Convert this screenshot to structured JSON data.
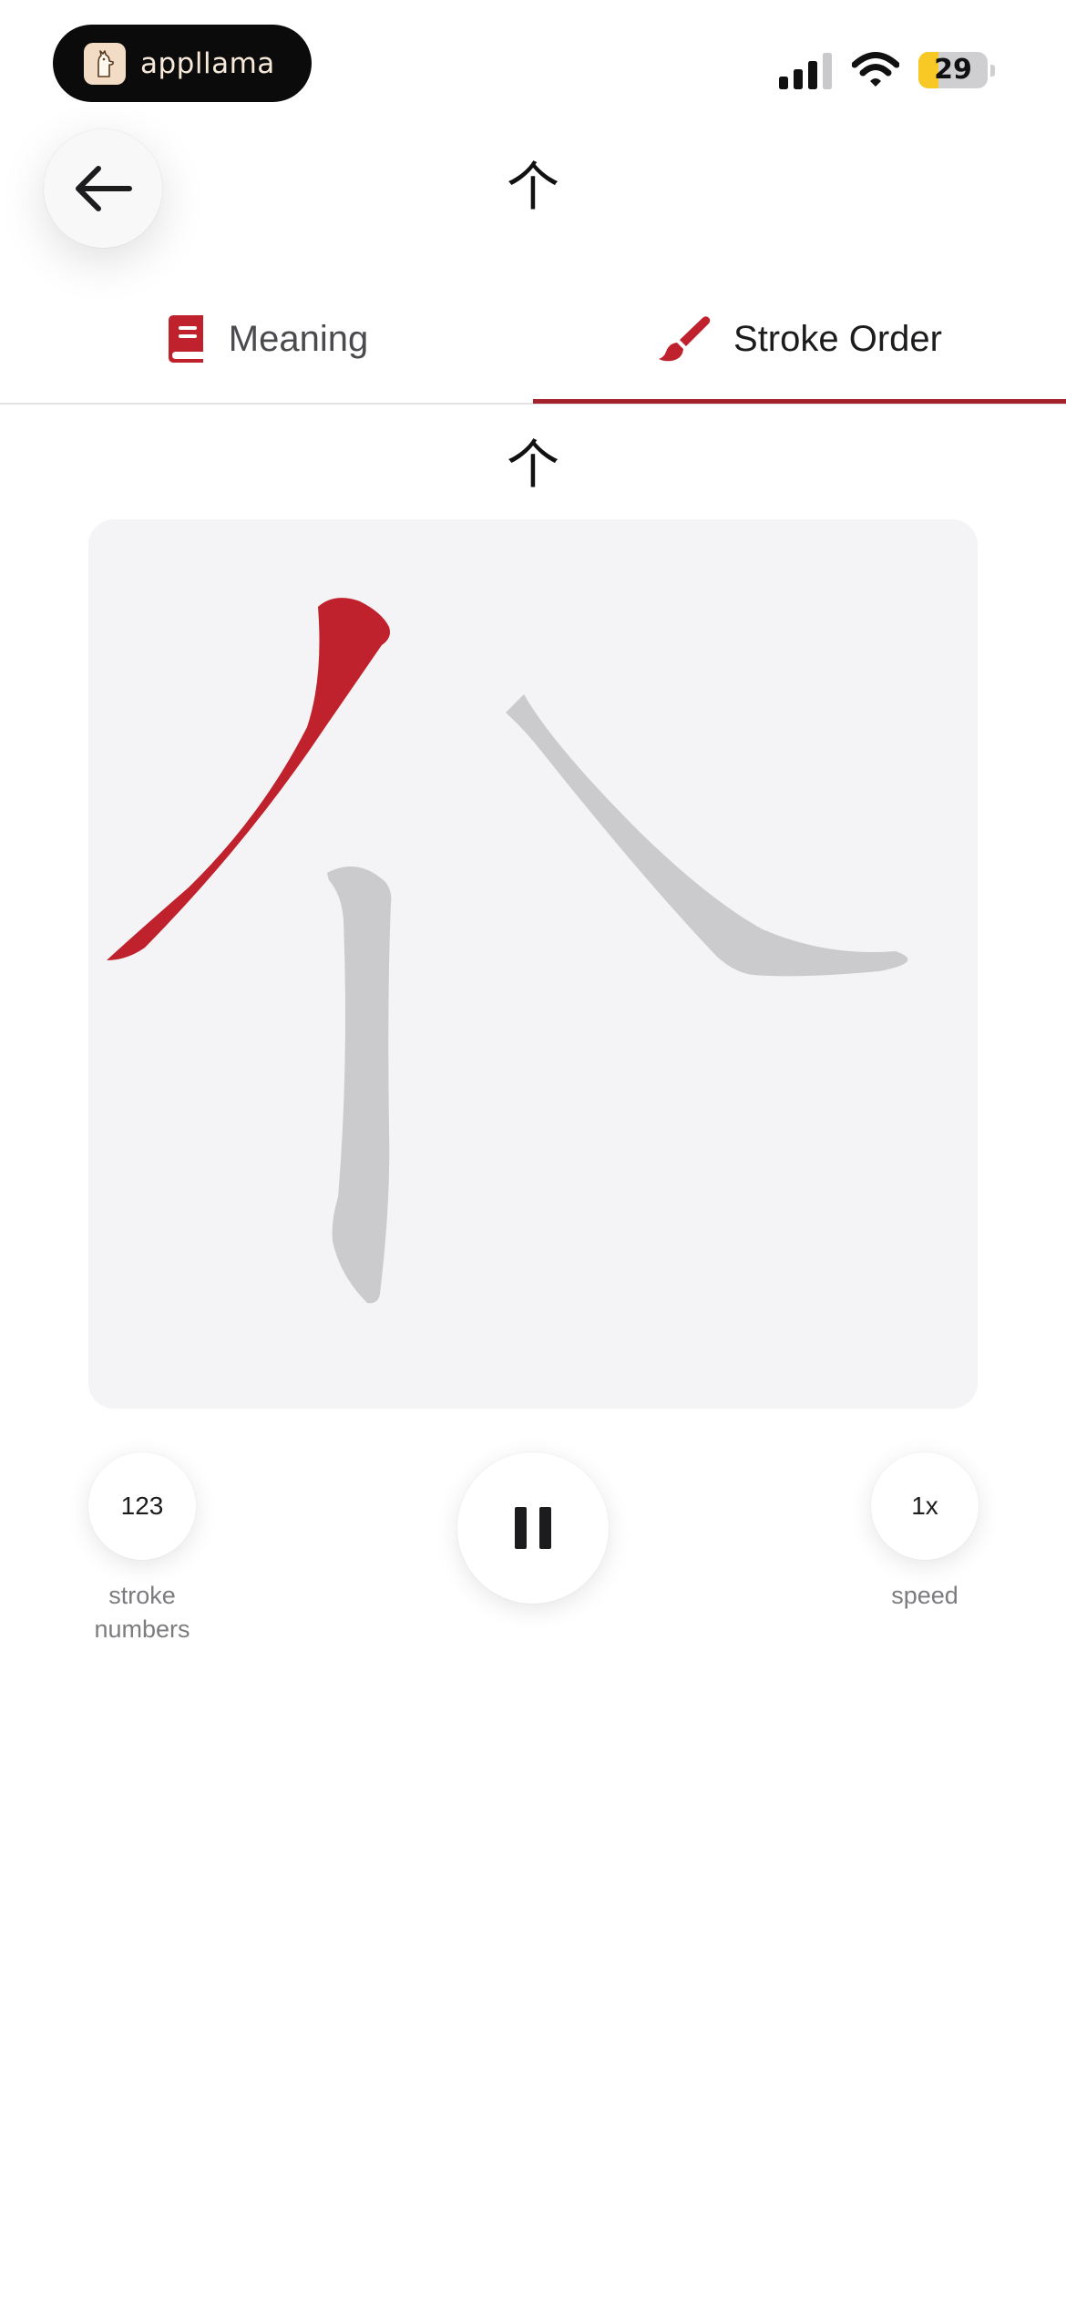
{
  "status_bar": {
    "app_name": "appllama",
    "battery": 29,
    "battery_label": "29",
    "icons": [
      "cellular-signal-icon",
      "wifi-icon",
      "battery-icon"
    ]
  },
  "header": {
    "back_icon": "arrow-left-icon",
    "character": "个"
  },
  "tabs": [
    {
      "label": "Meaning",
      "icon": "book-icon",
      "selected": false
    },
    {
      "label": "Stroke Order",
      "icon": "paintbrush-icon",
      "selected": true
    }
  ],
  "stroke_panel": {
    "character": "个",
    "highlight_color": "#C0222D",
    "pending_color": "#CBCBCD",
    "strokes_total": 3,
    "strokes_highlighted": 1
  },
  "controls": {
    "stroke_numbers": {
      "label": "123",
      "caption": "stroke\nnumbers"
    },
    "play_pause": {
      "state": "playing",
      "icon": "pause-icon"
    },
    "speed": {
      "label": "1x",
      "caption": "speed"
    }
  },
  "colors": {
    "accent": "#A3222C",
    "icon_red": "#C0222D",
    "canvas_bg": "#F4F4F6"
  }
}
